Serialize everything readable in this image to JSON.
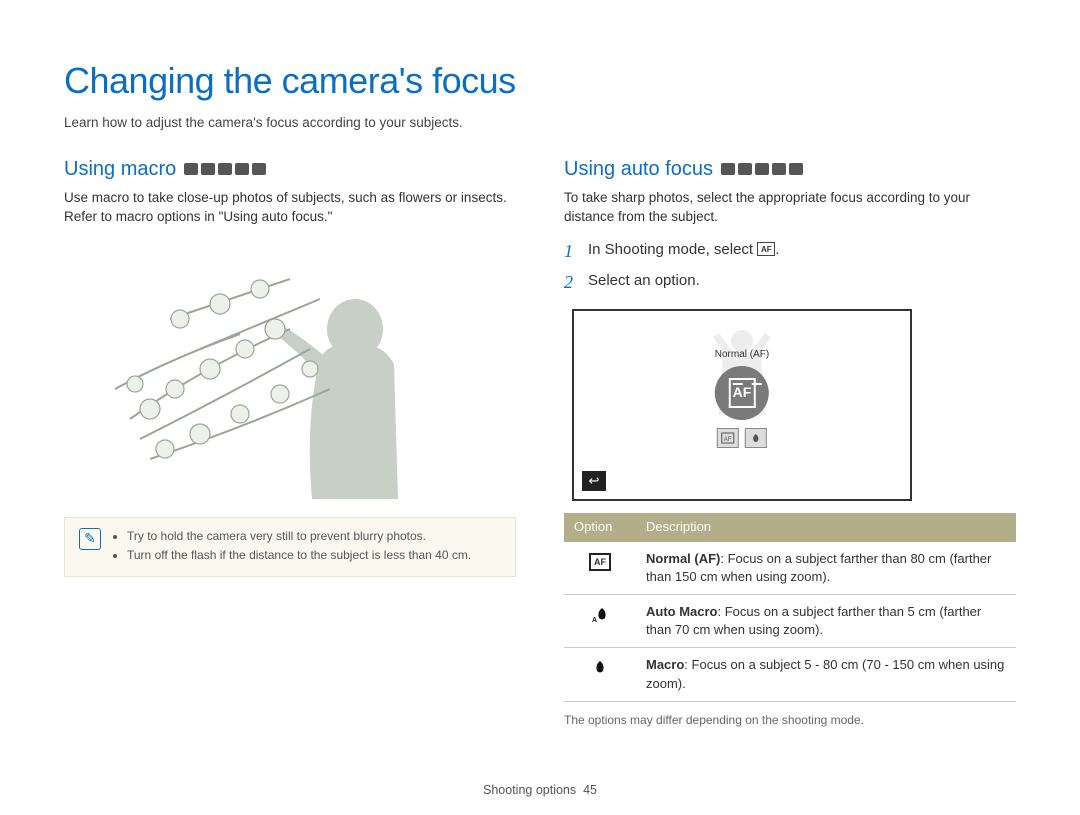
{
  "page": {
    "title": "Changing the camera's focus",
    "intro": "Learn how to adjust the camera's focus according to your subjects."
  },
  "left": {
    "heading": "Using macro",
    "body": "Use macro to take close-up photos of subjects, such as flowers or insects. Refer to macro options in \"Using auto focus.\"",
    "notes": [
      "Try to hold the camera very still to prevent blurry photos.",
      "Turn off the flash if the distance to the subject is less than 40 cm."
    ]
  },
  "right": {
    "heading": "Using auto focus",
    "body": "To take sharp photos, select the appropriate focus according to your distance from the subject.",
    "steps": [
      "In Shooting mode, select",
      "Select an option."
    ],
    "screen": {
      "label": "Normal (AF)",
      "af_text": "AF"
    },
    "table": {
      "headers": [
        "Option",
        "Description"
      ],
      "rows": [
        {
          "icon": "af",
          "name": "Normal (AF)",
          "desc": ": Focus on a subject farther than 80 cm (farther than 150 cm when using zoom)."
        },
        {
          "icon": "aflower",
          "name": "Auto Macro",
          "desc": ": Focus on a subject farther than 5 cm (farther than 70 cm when using zoom)."
        },
        {
          "icon": "flower",
          "name": "Macro",
          "desc": ": Focus on a subject 5 - 80 cm (70 - 150 cm when using zoom)."
        }
      ],
      "footnote": "The options may differ depending on the shooting mode."
    }
  },
  "footer": {
    "section": "Shooting options",
    "page": "45"
  }
}
